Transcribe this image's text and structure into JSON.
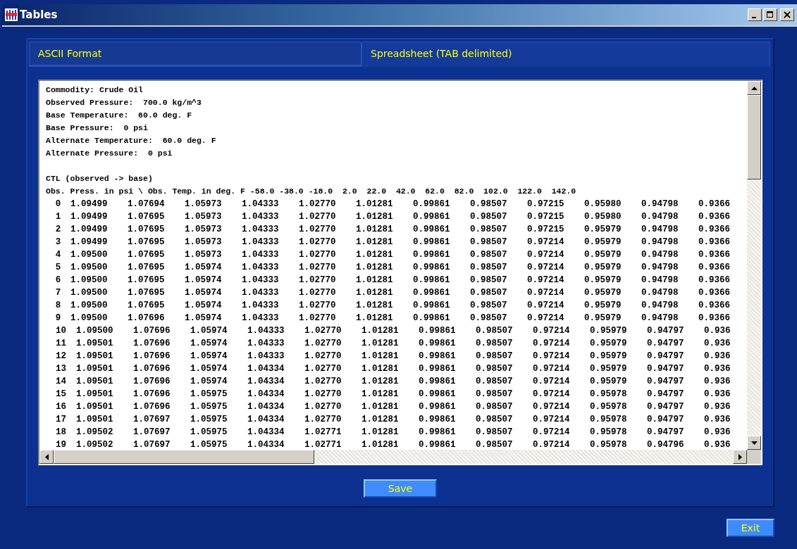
{
  "window": {
    "title": "Tables"
  },
  "tabs": [
    {
      "label": "ASCII Format",
      "selected": false
    },
    {
      "label": "Spreadsheet (TAB delimited)",
      "selected": true
    }
  ],
  "text_area": {
    "header_lines": [
      "Commodity: Crude Oil",
      "Observed Pressure:  700.0 kg/m^3",
      "Base Temperature:  60.0 deg. F",
      "Base Pressure:  0 psi",
      "Alternate Temperature:  60.0 deg. F",
      "Alternate Pressure:  0 psi"
    ],
    "lines": [
      "CTL (observed -> base)",
      "Obs. Press. in psi \\ Obs. Temp. in deg. F -58.0 -38.0 -18.0  2.0  22.0  42.0  62.0  82.0  102.0  122.0  142.0"
    ],
    "rows": [
      {
        "label": "0",
        "values": [
          "1.09499",
          "1.07694",
          "1.05973",
          "1.04333",
          "1.02770",
          "1.01281",
          "0.99861",
          "0.98507",
          "0.97215",
          "0.95980",
          "0.94798",
          "0.9366"
        ]
      },
      {
        "label": "1",
        "values": [
          "1.09499",
          "1.07695",
          "1.05973",
          "1.04333",
          "1.02770",
          "1.01281",
          "0.99861",
          "0.98507",
          "0.97215",
          "0.95980",
          "0.94798",
          "0.9366"
        ]
      },
      {
        "label": "2",
        "values": [
          "1.09499",
          "1.07695",
          "1.05973",
          "1.04333",
          "1.02770",
          "1.01281",
          "0.99861",
          "0.98507",
          "0.97215",
          "0.95979",
          "0.94798",
          "0.9366"
        ]
      },
      {
        "label": "3",
        "values": [
          "1.09499",
          "1.07695",
          "1.05973",
          "1.04333",
          "1.02770",
          "1.01281",
          "0.99861",
          "0.98507",
          "0.97214",
          "0.95979",
          "0.94798",
          "0.9366"
        ]
      },
      {
        "label": "4",
        "values": [
          "1.09500",
          "1.07695",
          "1.05973",
          "1.04333",
          "1.02770",
          "1.01281",
          "0.99861",
          "0.98507",
          "0.97214",
          "0.95979",
          "0.94798",
          "0.9366"
        ]
      },
      {
        "label": "5",
        "values": [
          "1.09500",
          "1.07695",
          "1.05974",
          "1.04333",
          "1.02770",
          "1.01281",
          "0.99861",
          "0.98507",
          "0.97214",
          "0.95979",
          "0.94798",
          "0.9366"
        ]
      },
      {
        "label": "6",
        "values": [
          "1.09500",
          "1.07695",
          "1.05974",
          "1.04333",
          "1.02770",
          "1.01281",
          "0.99861",
          "0.98507",
          "0.97214",
          "0.95979",
          "0.94798",
          "0.9366"
        ]
      },
      {
        "label": "7",
        "values": [
          "1.09500",
          "1.07695",
          "1.05974",
          "1.04333",
          "1.02770",
          "1.01281",
          "0.99861",
          "0.98507",
          "0.97214",
          "0.95979",
          "0.94798",
          "0.9366"
        ]
      },
      {
        "label": "8",
        "values": [
          "1.09500",
          "1.07695",
          "1.05974",
          "1.04333",
          "1.02770",
          "1.01281",
          "0.99861",
          "0.98507",
          "0.97214",
          "0.95979",
          "0.94798",
          "0.9366"
        ]
      },
      {
        "label": "9",
        "values": [
          "1.09500",
          "1.07696",
          "1.05974",
          "1.04333",
          "1.02770",
          "1.01281",
          "0.99861",
          "0.98507",
          "0.97214",
          "0.95979",
          "0.94798",
          "0.9366"
        ]
      },
      {
        "label": "10",
        "values": [
          "1.09500",
          "1.07696",
          "1.05974",
          "1.04333",
          "1.02770",
          "1.01281",
          "0.99861",
          "0.98507",
          "0.97214",
          "0.95979",
          "0.94797",
          "0.936"
        ]
      },
      {
        "label": "11",
        "values": [
          "1.09501",
          "1.07696",
          "1.05974",
          "1.04333",
          "1.02770",
          "1.01281",
          "0.99861",
          "0.98507",
          "0.97214",
          "0.95979",
          "0.94797",
          "0.936"
        ]
      },
      {
        "label": "12",
        "values": [
          "1.09501",
          "1.07696",
          "1.05974",
          "1.04333",
          "1.02770",
          "1.01281",
          "0.99861",
          "0.98507",
          "0.97214",
          "0.95979",
          "0.94797",
          "0.936"
        ]
      },
      {
        "label": "13",
        "values": [
          "1.09501",
          "1.07696",
          "1.05974",
          "1.04334",
          "1.02770",
          "1.01281",
          "0.99861",
          "0.98507",
          "0.97214",
          "0.95979",
          "0.94797",
          "0.936"
        ]
      },
      {
        "label": "14",
        "values": [
          "1.09501",
          "1.07696",
          "1.05974",
          "1.04334",
          "1.02770",
          "1.01281",
          "0.99861",
          "0.98507",
          "0.97214",
          "0.95979",
          "0.94797",
          "0.936"
        ]
      },
      {
        "label": "15",
        "values": [
          "1.09501",
          "1.07696",
          "1.05975",
          "1.04334",
          "1.02770",
          "1.01281",
          "0.99861",
          "0.98507",
          "0.97214",
          "0.95978",
          "0.94797",
          "0.936"
        ]
      },
      {
        "label": "16",
        "values": [
          "1.09501",
          "1.07696",
          "1.05975",
          "1.04334",
          "1.02770",
          "1.01281",
          "0.99861",
          "0.98507",
          "0.97214",
          "0.95978",
          "0.94797",
          "0.936"
        ]
      },
      {
        "label": "17",
        "values": [
          "1.09501",
          "1.07697",
          "1.05975",
          "1.04334",
          "1.02770",
          "1.01281",
          "0.99861",
          "0.98507",
          "0.97214",
          "0.95978",
          "0.94797",
          "0.936"
        ]
      },
      {
        "label": "18",
        "values": [
          "1.09502",
          "1.07697",
          "1.05975",
          "1.04334",
          "1.02771",
          "1.01281",
          "0.99861",
          "0.98507",
          "0.97214",
          "0.95978",
          "0.94797",
          "0.936"
        ]
      },
      {
        "label": "19",
        "values": [
          "1.09502",
          "1.07697",
          "1.05975",
          "1.04334",
          "1.02771",
          "1.01281",
          "0.99861",
          "0.98507",
          "0.97214",
          "0.95978",
          "0.94796",
          "0.936"
        ]
      }
    ]
  },
  "buttons": {
    "save": "Save",
    "exit": "Exit"
  }
}
